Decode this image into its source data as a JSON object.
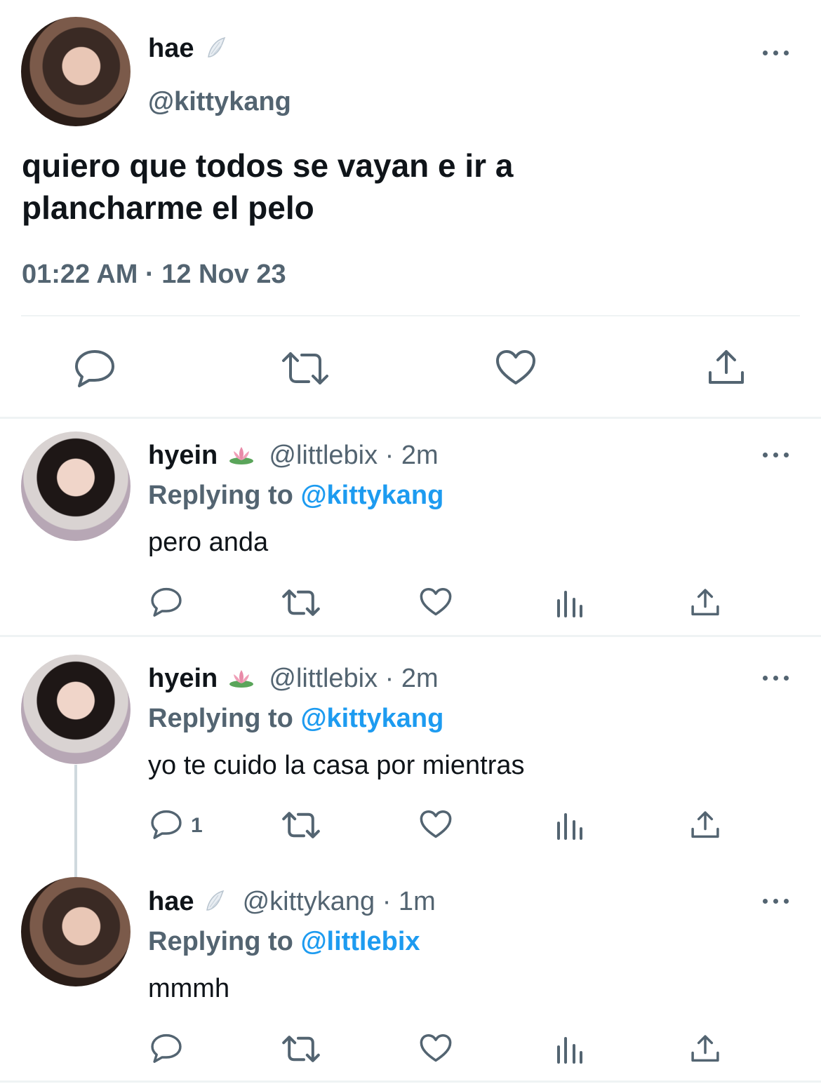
{
  "main_tweet": {
    "name": "hae",
    "name_emoji": "wing-emoji",
    "handle": "@kittykang",
    "text_line1": "quiero que todos se vayan e ir a",
    "text_line2": "plancharme el pelo",
    "timestamp": "01:22 AM · 12 Nov 23"
  },
  "replies": [
    {
      "name": "hyein",
      "name_emoji": "lotus-emoji",
      "handle": "@littlebix",
      "time": "· 2m",
      "replying_label": "Replying to",
      "replying_to": "@kittykang",
      "text": "pero anda",
      "reply_count": ""
    },
    {
      "name": "hyein",
      "name_emoji": "lotus-emoji",
      "handle": "@littlebix",
      "time": "· 2m",
      "replying_label": "Replying to",
      "replying_to": "@kittykang",
      "text": "yo te cuido la casa por mientras",
      "reply_count": "1"
    },
    {
      "name": "hae",
      "name_emoji": "wing-emoji",
      "handle": "@kittykang",
      "time": "· 1m",
      "replying_label": "Replying to",
      "replying_to": "@littlebix",
      "text": "mmmh",
      "reply_count": ""
    }
  ],
  "colors": {
    "text": "#0f1419",
    "secondary": "#536471",
    "accent": "#1d9bf0",
    "divider": "#eff3f4"
  }
}
